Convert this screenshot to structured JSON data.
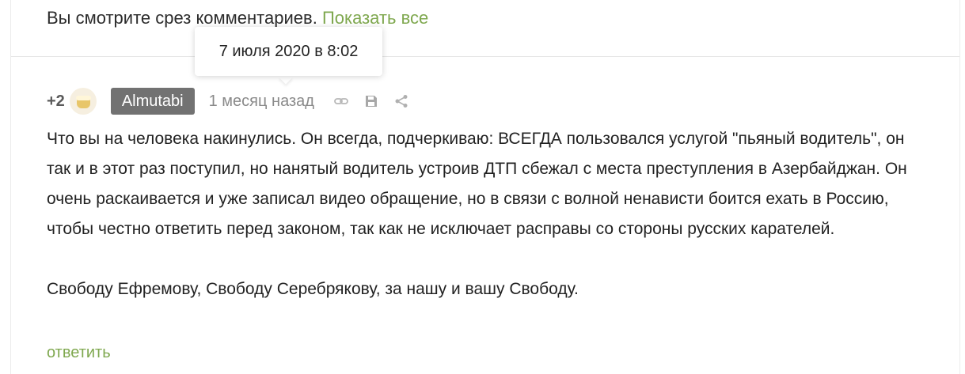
{
  "banner": {
    "prefix": "Вы смотрите срез комментариев.",
    "show_all_link": "Показать все"
  },
  "tooltip": {
    "text": "7 июля 2020 в 8:02"
  },
  "comment": {
    "rating": "+2",
    "author": "Almutabi",
    "time_ago": "1 месяц назад",
    "paragraphs": [
      "Что вы на человека накинулись. Он всегда, подчеркиваю: ВСЕГДА пользовался услугой \"пьяный водитель\", он так и в этот раз поступил, но нанятый водитель устроив ДТП сбежал с места преступления в Азербайджан. Он очень раскаивается и уже записал видео обращение, но в связи с волной ненависти боится ехать в Россию, чтобы честно ответить перед законом, так как не исключает расправы со стороны русских карателей.",
      "Свободу Ефремову, Свободу Серебрякову, за нашу и вашу Свободу."
    ],
    "reply_label": "ответить",
    "icons": [
      "link-icon",
      "save-icon",
      "share-icon"
    ]
  },
  "colors": {
    "accent": "#7fa84f",
    "username_bg": "#727272",
    "muted_text": "#8a8a8a"
  }
}
